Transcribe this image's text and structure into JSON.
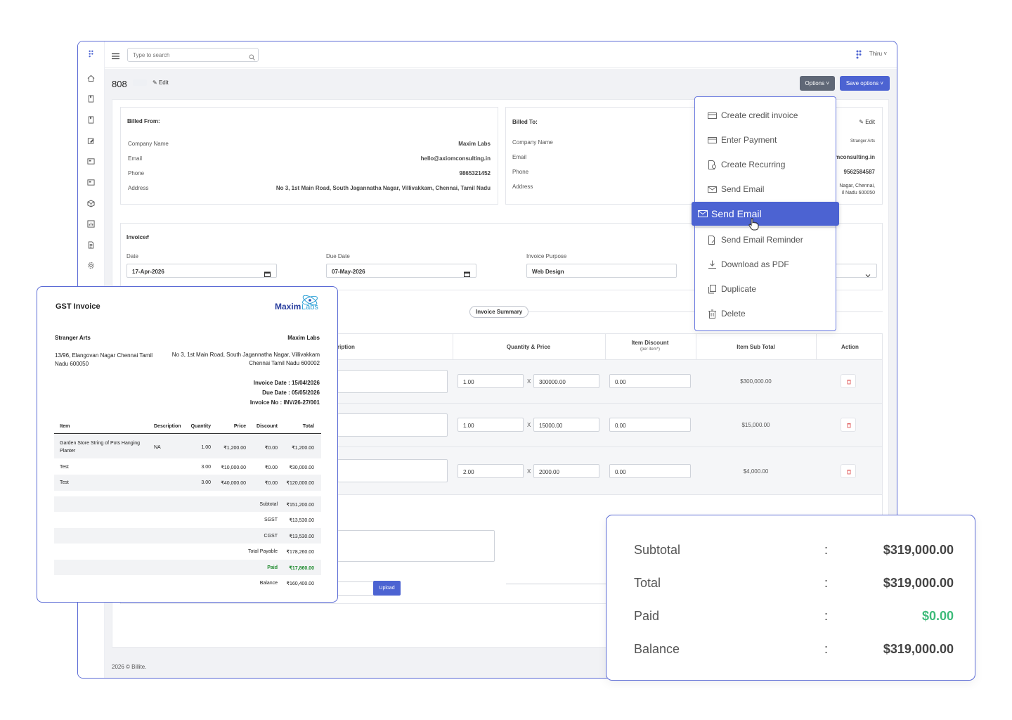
{
  "topbar": {
    "search_placeholder": "Type to search",
    "user_name": "Thiru ˅"
  },
  "invoice_header": {
    "number": "808",
    "edit_label": "Edit",
    "options_label": "Options ˅",
    "save_options_label": "Save options ˅"
  },
  "billed_from": {
    "title": "Billed From:",
    "fields": [
      {
        "label": "Company Name",
        "value": "Maxim Labs"
      },
      {
        "label": "Email",
        "value": "hello@axiomconsulting.in"
      },
      {
        "label": "Phone",
        "value": "9865321452"
      },
      {
        "label": "Address",
        "value": "No 3, 1st Main Road, South Jagannatha Nagar, Villivakkam, Chennai, Tamil Nadu"
      }
    ]
  },
  "billed_to": {
    "title": "Billed To:",
    "edit_label": "Edit",
    "company_label": "Company Name",
    "company_value": "Stranger Arts",
    "email_label": "Email",
    "email_value": "mconsulting.in",
    "phone_label": "Phone",
    "phone_value": "9562584587",
    "address_label": "Address",
    "address_line1": "Nagar, Chennai,",
    "address_line2": "il Nadu 600050"
  },
  "invoice_details": {
    "title": "Invoice#",
    "date_label": "Date",
    "date_value": "17-Apr-2026",
    "due_label": "Due Date",
    "due_value": "07-May-2026",
    "purpose_label": "Invoice Purpose",
    "purpose_value": "Web Design"
  },
  "summary_tag": "Invoice Summary",
  "items_table": {
    "headers": {
      "description": "ription",
      "qty_price": "Quantity & Price",
      "discount": "Item Discount",
      "discount_sub": "(per item*)",
      "subtotal": "Item Sub Total",
      "action": "Action"
    },
    "rows": [
      {
        "qty": "1.00",
        "x": "X",
        "price": "300000.00",
        "discount": "0.00",
        "subtotal": "$300,000.00"
      },
      {
        "qty": "1.00",
        "x": "X",
        "price": "15000.00",
        "discount": "0.00",
        "subtotal": "$15,000.00"
      },
      {
        "qty": "2.00",
        "x": "X",
        "price": "2000.00",
        "discount": "0.00",
        "subtotal": "$4,000.00"
      }
    ],
    "upload_label": "Upload"
  },
  "footer": "2026 © Billite.",
  "dropdown": {
    "items": [
      "Create credit invoice",
      "Enter Payment",
      "Create Recurring",
      "Send Email",
      "Send Email Reminder",
      "Download as PDF",
      "Duplicate",
      "Delete"
    ],
    "active": "Send Email"
  },
  "gst_invoice": {
    "title": "GST Invoice",
    "logo_text": "MaximLabs",
    "to_name": "Stranger Arts",
    "to_address": "13/96, Elangovan Nagar Chennai Tamil Nadu 600050",
    "from_name": "Maxim Labs",
    "from_address_line1": "No 3, 1st Main Road, South Jagannatha Nagar, Villivakkam",
    "from_address_line2": "Chennai Tamil Nadu 600002",
    "invoice_date": "Invoice Date : 15/04/2026",
    "due_date": "Due Date : 05/05/2026",
    "invoice_no": "Invoice No : INV/26-27/001",
    "columns": [
      "Item",
      "Description",
      "Quantity",
      "Price",
      "Discount",
      "Total"
    ],
    "rows": [
      {
        "item_line1": "Garden Store String of Pots Hanging",
        "item_line2": "Planter",
        "description": "NA",
        "quantity": "1.00",
        "price": "₹1,200.00",
        "discount": "₹0.00",
        "total": "₹1,200.00"
      },
      {
        "item_line1": "Test",
        "item_line2": "",
        "description": "",
        "quantity": "3.00",
        "price": "₹10,000.00",
        "discount": "₹0.00",
        "total": "₹30,000.00"
      },
      {
        "item_line1": "Test",
        "item_line2": "",
        "description": "",
        "quantity": "3.00",
        "price": "₹40,000.00",
        "discount": "₹0.00",
        "total": "₹120,000.00"
      }
    ],
    "totals": [
      {
        "label": "Subtotal",
        "value": "₹151,200.00"
      },
      {
        "label": "SGST",
        "value": "₹13,530.00"
      },
      {
        "label": "CGST",
        "value": "₹13,530.00"
      },
      {
        "label": "Total Payable",
        "value": "₹178,260.00"
      },
      {
        "label": "Paid",
        "value": "₹17,860.00"
      },
      {
        "label": "Balance",
        "value": "₹160,400.00"
      }
    ]
  },
  "summary_card": {
    "rows": [
      {
        "label": "Subtotal",
        "colon": ":",
        "value": "$319,000.00"
      },
      {
        "label": "Total",
        "colon": ":",
        "value": "$319,000.00"
      },
      {
        "label": "Paid",
        "colon": ":",
        "value": "$0.00"
      },
      {
        "label": "Balance",
        "colon": ":",
        "value": "$319,000.00"
      }
    ]
  },
  "colors": {
    "accent": "#4c63d2",
    "frame_border": "#5b6bd5",
    "paid_green": "#3dbb7a",
    "gst_paid_green": "#1e8a2e",
    "delete_red": "#e05a5a"
  },
  "icons": [
    "brand-icon",
    "menu-icon",
    "search-icon",
    "home-icon",
    "bookmark-icon",
    "tag-icon",
    "card-icon",
    "box-icon",
    "chart-icon",
    "document-icon",
    "gear-icon",
    "pencil-icon",
    "calendar-icon",
    "chevron-down-icon",
    "trash-icon",
    "credit-card-icon",
    "mail-icon",
    "download-icon",
    "copy-icon",
    "cursor-hand-icon"
  ]
}
